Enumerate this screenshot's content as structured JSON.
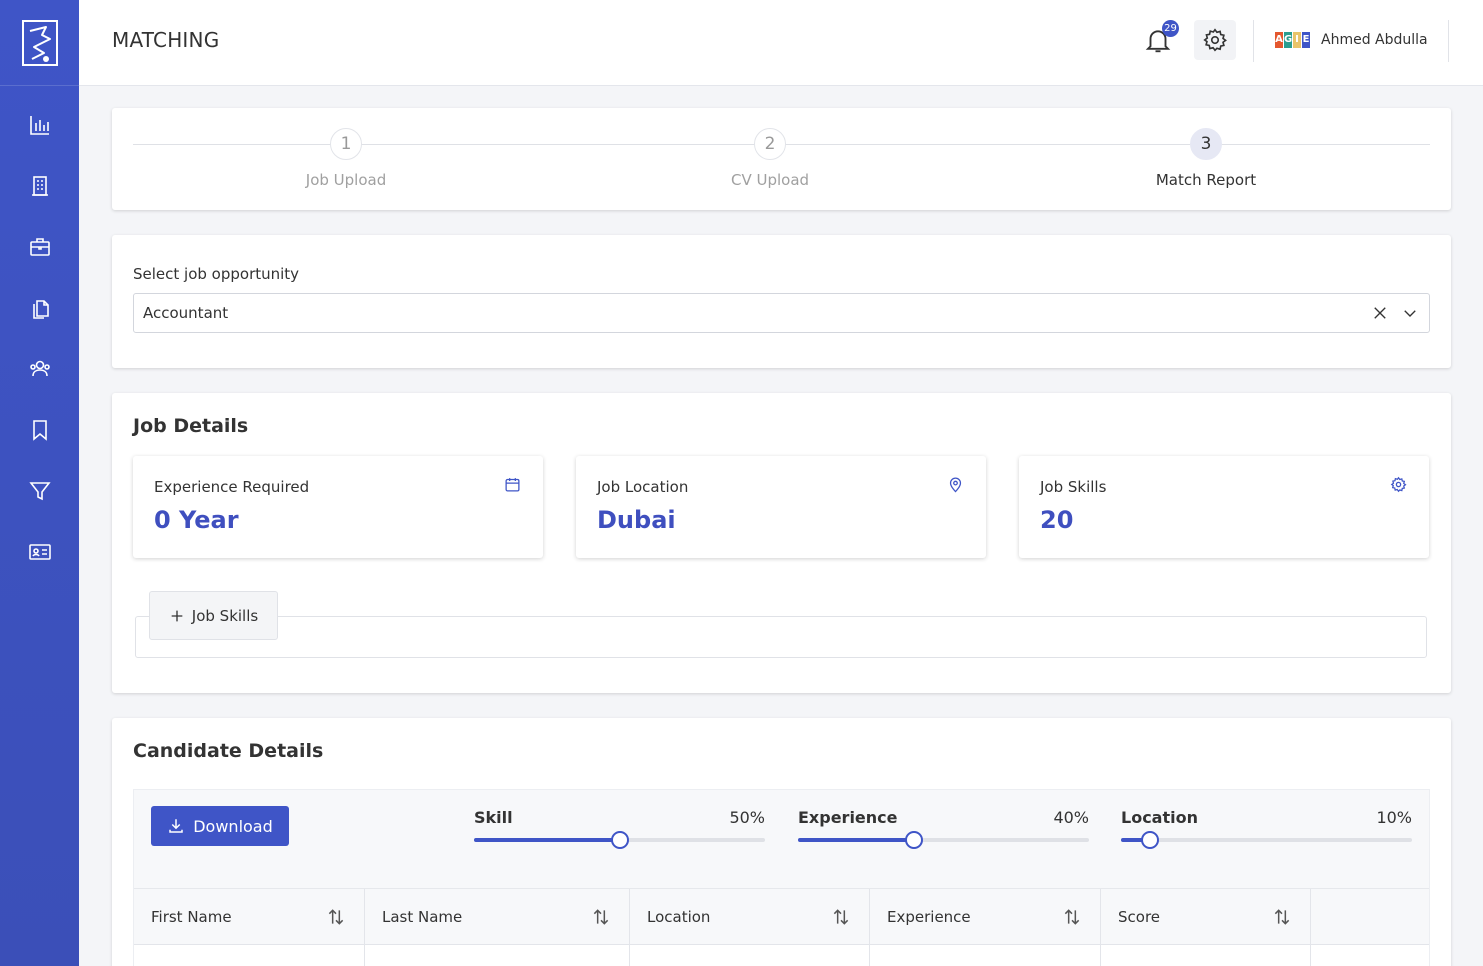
{
  "header": {
    "title": "MATCHING",
    "notification_count": "29",
    "company_logo_letters": [
      "A",
      "G",
      "I",
      "E"
    ],
    "user_name": "Ahmed Abdulla"
  },
  "sidebar": {
    "items": [
      {
        "icon": "bar-chart-icon"
      },
      {
        "icon": "building-icon"
      },
      {
        "icon": "briefcase-icon"
      },
      {
        "icon": "documents-icon"
      },
      {
        "icon": "users-icon"
      },
      {
        "icon": "bookmark-icon"
      },
      {
        "icon": "filter-icon"
      },
      {
        "icon": "id-card-icon"
      }
    ]
  },
  "stepper": {
    "steps": [
      {
        "number": "1",
        "label": "Job Upload"
      },
      {
        "number": "2",
        "label": "CV Upload"
      },
      {
        "number": "3",
        "label": "Match Report"
      }
    ],
    "active_step": 3
  },
  "job_select": {
    "label": "Select job opportunity",
    "value": "Accountant"
  },
  "job_details": {
    "title": "Job Details",
    "cards": [
      {
        "label": "Experience Required",
        "value": "0 Year",
        "icon": "calendar-icon"
      },
      {
        "label": "Job Location",
        "value": "Dubai",
        "icon": "location-pin-icon"
      },
      {
        "label": "Job Skills",
        "value": "20",
        "icon": "gear-icon"
      }
    ],
    "skills_button": "Job Skills"
  },
  "candidate_details": {
    "title": "Candidate Details",
    "download_label": "Download",
    "weights": [
      {
        "name": "Skill",
        "percent_label": "50%",
        "value": 0.5
      },
      {
        "name": "Experience",
        "percent_label": "40%",
        "value": 0.4
      },
      {
        "name": "Location",
        "percent_label": "10%",
        "value": 0.1
      }
    ],
    "columns": [
      "First Name",
      "Last Name",
      "Location",
      "Experience",
      "Score"
    ]
  },
  "colors": {
    "accent": "#3f55c7",
    "value_text": "#3f4fbf"
  }
}
